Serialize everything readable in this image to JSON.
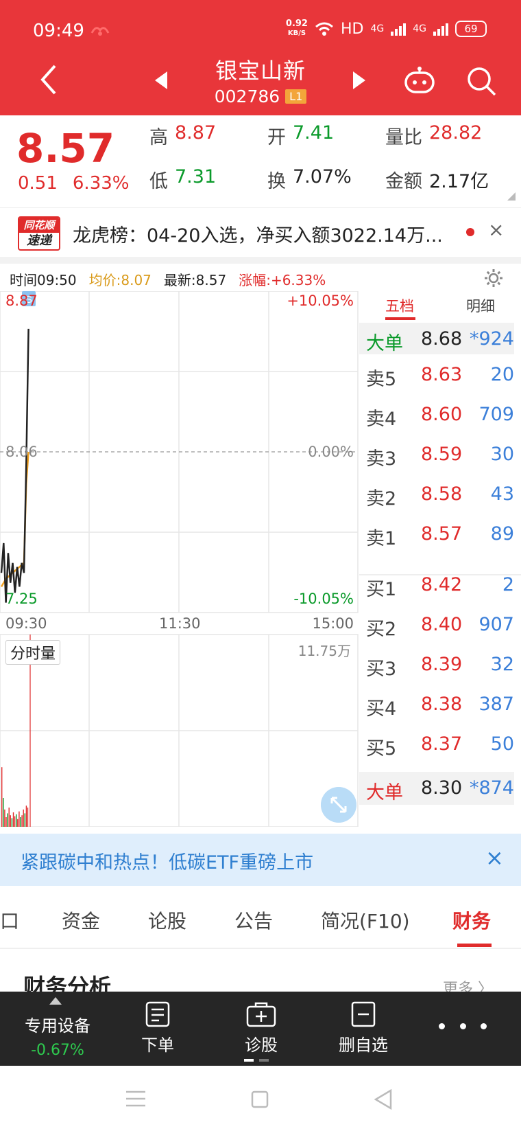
{
  "status_bar": {
    "time": "09:49",
    "net_speed_value": "0.92",
    "net_speed_unit": "KB/S",
    "network": "HD",
    "signal1": "4G",
    "signal2": "4G",
    "battery": "69"
  },
  "header": {
    "stock_name": "银宝山新",
    "stock_code": "002786",
    "level_badge": "L1",
    "icons": [
      "back-icon",
      "prev-icon",
      "next-icon",
      "robot-icon",
      "search-icon"
    ]
  },
  "quote": {
    "price": "8.57",
    "change": "0.51",
    "change_pct": "6.33%",
    "high_label": "高",
    "high": "8.87",
    "open_label": "开",
    "open": "7.41",
    "vol_ratio_label": "量比",
    "vol_ratio": "28.82",
    "low_label": "低",
    "low": "7.31",
    "turnover_label": "换",
    "turnover": "7.07%",
    "amount_label": "金额",
    "amount": "2.17亿"
  },
  "news": {
    "logo_top": "同花顺",
    "logo_bottom": "速递",
    "text": "龙虎榜：04-20入选，净买入额3022.14万...",
    "close": "×"
  },
  "chart_info": {
    "time": "时间09:50",
    "avg": "均价:8.07",
    "latest": "最新:8.57",
    "change": "涨幅:+6.33%"
  },
  "chart_data": {
    "type": "line",
    "y_top_label": "8.87",
    "y_mid_label": "8.06",
    "y_bottom_label": "7.25",
    "pct_top_label": "+10.05%",
    "pct_mid_label": "0.00%",
    "pct_bottom_label": "-10.05%",
    "x_labels": [
      "09:30",
      "11:30",
      "15:00"
    ],
    "ylim": [
      7.25,
      8.87
    ],
    "marker": "S",
    "series": [
      {
        "values": [
          7.45,
          7.6,
          7.3,
          7.55,
          7.4,
          7.5,
          7.35,
          7.48,
          7.38,
          7.5,
          7.45,
          8.0,
          8.68
        ]
      },
      {
        "values": [
          7.38,
          7.4,
          7.42,
          7.43,
          7.44,
          7.45,
          7.46,
          7.47,
          7.48,
          7.49,
          7.5,
          7.9,
          8.06
        ]
      }
    ],
    "volume": {
      "label": "分时量",
      "max_label": "11.75万",
      "bars": [
        0.62,
        0.3,
        0.18,
        0.1,
        0.14,
        0.2,
        0.12,
        0.09,
        0.15,
        0.11,
        0.13,
        0.08,
        0.16,
        0.1,
        0.12,
        0.18,
        0.14,
        0.22,
        0.2
      ]
    }
  },
  "order_book": {
    "tab_five": "五档",
    "tab_detail": "明细",
    "big_top": {
      "label": "大单",
      "price": "8.68",
      "volume": "*924"
    },
    "asks": [
      {
        "label": "卖5",
        "price": "8.63",
        "volume": "20"
      },
      {
        "label": "卖4",
        "price": "8.60",
        "volume": "709"
      },
      {
        "label": "卖3",
        "price": "8.59",
        "volume": "30"
      },
      {
        "label": "卖2",
        "price": "8.58",
        "volume": "43"
      },
      {
        "label": "卖1",
        "price": "8.57",
        "volume": "89"
      }
    ],
    "bids": [
      {
        "label": "买1",
        "price": "8.42",
        "volume": "2"
      },
      {
        "label": "买2",
        "price": "8.40",
        "volume": "907"
      },
      {
        "label": "买3",
        "price": "8.39",
        "volume": "32"
      },
      {
        "label": "买4",
        "price": "8.38",
        "volume": "387"
      },
      {
        "label": "买5",
        "price": "8.37",
        "volume": "50"
      }
    ],
    "big_bottom": {
      "label": "大单",
      "price": "8.30",
      "volume": "*874"
    }
  },
  "promo": {
    "text": "紧跟碳中和热点！低碳ETF重磅上市",
    "close": "×"
  },
  "tabs": [
    "口",
    "资金",
    "论股",
    "公告",
    "简况(F10)",
    "财务"
  ],
  "section": {
    "title": "财务分析",
    "more": "更多 〉"
  },
  "toolbar": {
    "device_label": "专用设备",
    "device_pct": "-0.67%",
    "order_label": "下单",
    "diag_label": "诊股",
    "del_label": "删自选"
  },
  "colors": {
    "header_red": "#e8363a",
    "up_red": "#e02b2b",
    "down_green": "#0a9a2a",
    "volume_blue": "#3b7fd9",
    "avg_line": "#f0a020"
  }
}
